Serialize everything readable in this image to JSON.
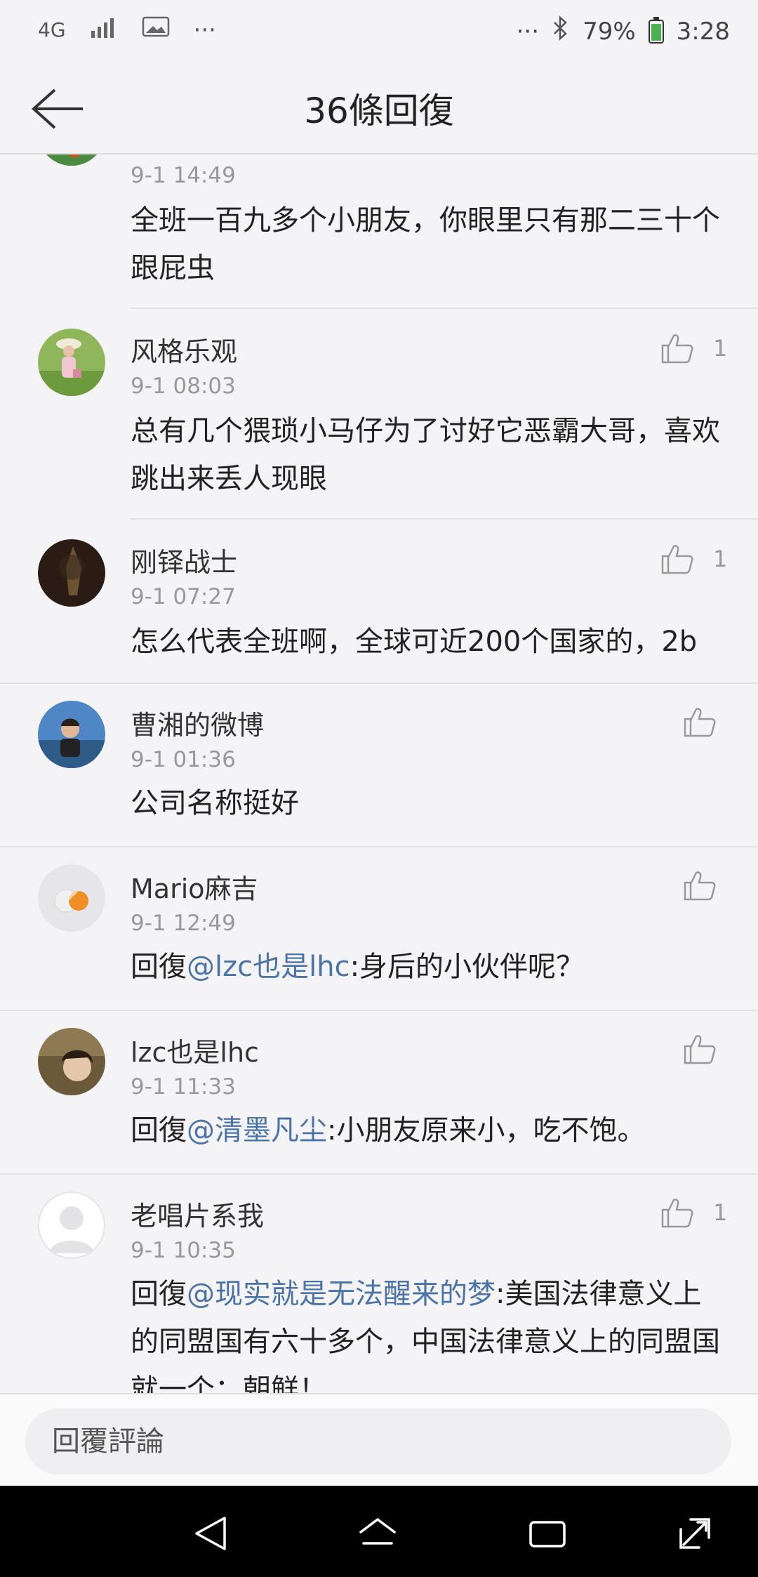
{
  "status_bar": {
    "network": "4G",
    "overflow_left": "···",
    "overflow_right": "···",
    "battery": "79%",
    "time": "3:28"
  },
  "header": {
    "title": "36條回復"
  },
  "comments": [
    {
      "name": "",
      "time": "9-1 14:49",
      "text": "全班一百九多个小朋友，你眼里只有那二三十个跟屁虫",
      "likes": ""
    },
    {
      "name": "风格乐观",
      "time": "9-1 08:03",
      "text": "总有几个猥琐小马仔为了讨好它恶霸大哥，喜欢跳出来丢人现眼",
      "likes": "1"
    },
    {
      "name": "刚铎战士",
      "time": "9-1 07:27",
      "text": "怎么代表全班啊，全球可近200个国家的，2b",
      "likes": "1"
    },
    {
      "name": "曹湘的微博",
      "time": "9-1 01:36",
      "text": "公司名称挺好",
      "likes": ""
    },
    {
      "name": "Mario麻吉",
      "time": "9-1 12:49",
      "reply_prefix": "回復",
      "mention": "@lzc也是lhc",
      "text": ":身后的小伙伴呢？",
      "likes": ""
    },
    {
      "name": "lzc也是lhc",
      "time": "9-1 11:33",
      "reply_prefix": "回復",
      "mention": "@清墨凡尘",
      "text": ":小朋友原来小，吃不饱。",
      "likes": ""
    },
    {
      "name": "老唱片系我",
      "time": "9-1 10:35",
      "reply_prefix": "回復",
      "mention": "@现实就是无法醒来的梦",
      "text": ":美国法律意义上的同盟国有六十多个，中国法律意义上的同盟国就一个：朝鲜！",
      "likes": "1"
    }
  ],
  "reply_bar": {
    "placeholder": "回覆評論"
  },
  "colors": {
    "mention": "#4a73a8",
    "meta": "#999999",
    "background": "#f4f4f6"
  }
}
